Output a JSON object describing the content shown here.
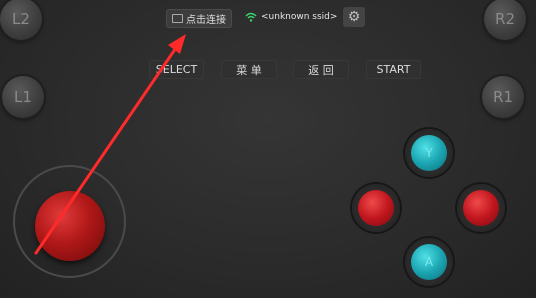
{
  "top": {
    "connect_label": "点击连接",
    "ssid": "<unknown ssid>",
    "settings_icon": "gear-icon",
    "wifi_icon": "wifi-icon"
  },
  "shoulders": {
    "l2": "L2",
    "r2": "R2",
    "l1": "L1",
    "r1": "R1"
  },
  "menu": {
    "select": "SELECT",
    "menu": "菜 单",
    "back": "返 回",
    "start": "START"
  },
  "face_buttons": {
    "top": "Y",
    "bottom": "A"
  },
  "colors": {
    "accent_red": "#c1161e",
    "accent_cyan": "#1ca6b3",
    "wifi_green": "#3cd16a",
    "arrow_red": "#ff2a2a"
  }
}
